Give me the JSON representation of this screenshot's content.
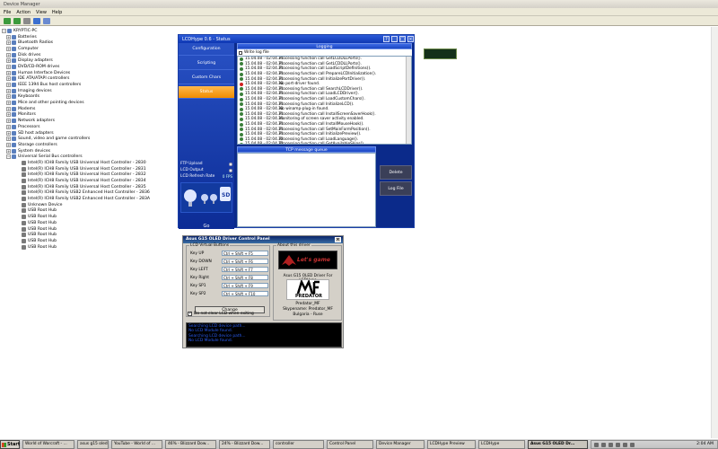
{
  "device_manager": {
    "title": "Device Manager",
    "menu": [
      "File",
      "Action",
      "View",
      "Help"
    ],
    "root": "KRYPTIC-PC",
    "tree": [
      {
        "label": "Batteries",
        "expanded": false
      },
      {
        "label": "Bluetooth Radios",
        "expanded": false
      },
      {
        "label": "Computer",
        "expanded": false
      },
      {
        "label": "Disk drives",
        "expanded": false
      },
      {
        "label": "Display adapters",
        "expanded": false
      },
      {
        "label": "DVD/CD-ROM drives",
        "expanded": false
      },
      {
        "label": "Human Interface Devices",
        "expanded": false
      },
      {
        "label": "IDE ATA/ATAPI controllers",
        "expanded": false
      },
      {
        "label": "IEEE 1394 Bus host controllers",
        "expanded": false
      },
      {
        "label": "Imaging devices",
        "expanded": false
      },
      {
        "label": "Keyboards",
        "expanded": false
      },
      {
        "label": "Mice and other pointing devices",
        "expanded": false
      },
      {
        "label": "Modems",
        "expanded": false
      },
      {
        "label": "Monitors",
        "expanded": false
      },
      {
        "label": "Network adapters",
        "expanded": false
      },
      {
        "label": "Processors",
        "expanded": false
      },
      {
        "label": "SD host adapters",
        "expanded": false
      },
      {
        "label": "Sound, video and game controllers",
        "expanded": false
      },
      {
        "label": "Storage controllers",
        "expanded": false
      },
      {
        "label": "System devices",
        "expanded": false
      },
      {
        "label": "Universal Serial Bus controllers",
        "expanded": true
      }
    ],
    "usb_children": [
      "Intel(R) ICH8 Family USB Universal Host Controller - 2830",
      "Intel(R) ICH8 Family USB Universal Host Controller - 2831",
      "Intel(R) ICH8 Family USB Universal Host Controller - 2832",
      "Intel(R) ICH8 Family USB Universal Host Controller - 2834",
      "Intel(R) ICH8 Family USB Universal Host Controller - 2835",
      "Intel(R) ICH8 Family USB2 Enhanced Host Controller - 2836",
      "Intel(R) ICH8 Family USB2 Enhanced Host Controller - 283A",
      "Unknown Device",
      "USB Root Hub",
      "USB Root Hub",
      "USB Root Hub",
      "USB Root Hub",
      "USB Root Hub",
      "USB Root Hub",
      "USB Root Hub"
    ]
  },
  "lcdhype": {
    "title": "LCDHype 0.6 - Status",
    "nav": [
      "Configuration",
      "Scripting",
      "Custom Chars",
      "Status"
    ],
    "active_nav": "Status",
    "options": [
      {
        "label": "FTP Upload",
        "value": ""
      },
      {
        "label": "LCD Output",
        "value": ""
      },
      {
        "label": "LCD Refresh Rate",
        "value": "0 FPS"
      }
    ],
    "go_label": "Go",
    "logging_header": "Logging",
    "write_log_label": "Write log file",
    "log_entries": [
      {
        "time": "15.04.08 - 02:04.31",
        "msg": "Processing function call GetLCDDLLPorts().",
        "error": false
      },
      {
        "time": "15.04.08 - 02:04.31",
        "msg": "Processing function call GetLCDDLLPorts().",
        "error": false
      },
      {
        "time": "15.04.08 - 02:04.31",
        "msg": "Processing function call LoadScriptDefinitions().",
        "error": false
      },
      {
        "time": "15.04.08 - 02:04.31",
        "msg": "Processing function call PrepareLCDInitialization().",
        "error": false
      },
      {
        "time": "15.04.08 - 02:04.31",
        "msg": "Processing function call InitializePortDriver().",
        "error": false
      },
      {
        "time": "15.04.08 - 02:04.31",
        "msg": "No port-driver found.",
        "error": true
      },
      {
        "time": "15.04.08 - 02:04.31",
        "msg": "Processing function call SearchLCDDriver().",
        "error": false
      },
      {
        "time": "15.04.08 - 02:04.31",
        "msg": "Processing function call LoadLCDDriver().",
        "error": false
      },
      {
        "time": "15.04.08 - 02:04.31",
        "msg": "Processing function call LoadCustomChars().",
        "error": false
      },
      {
        "time": "15.04.08 - 02:04.31",
        "msg": "Processing function call InitializeLCD().",
        "error": false
      },
      {
        "time": "15.04.08 - 02:04.31",
        "msg": "No winamp-plug-in found.",
        "error": false
      },
      {
        "time": "15.04.08 - 02:04.31",
        "msg": "Processing function call InstallScreenSaverHook().",
        "error": false
      },
      {
        "time": "15.04.08 - 02:04.31",
        "msg": "Monitoring of screen saver activity enabled.",
        "error": false
      },
      {
        "time": "15.04.08 - 02:04.31",
        "msg": "Processing function call InstallMouseHook().",
        "error": false
      },
      {
        "time": "15.04.08 - 02:04.31",
        "msg": "Processing function call SetMainFormPosition().",
        "error": false
      },
      {
        "time": "15.04.08 - 02:04.31",
        "msg": "Processing function call InitializePreview().",
        "error": false
      },
      {
        "time": "15.04.08 - 02:04.32",
        "msg": "Processing function call LoadLanguage().",
        "error": false
      },
      {
        "time": "15.04.08 - 02:04.32",
        "msg": "Processing function call GetAvailableSkins().",
        "error": false
      }
    ],
    "tcp_header": "TCP message queue",
    "side_buttons": [
      "Delete",
      "Log File"
    ]
  },
  "asus_panel": {
    "title": "Asus G15 OLED Driver Control Panel",
    "virtual_buttons_legend": "LCD Virtual Buttons",
    "keys": [
      {
        "label": "Key UP",
        "value": "Ctrl + Shift + F5"
      },
      {
        "label": "Key DOWN",
        "value": "Ctrl + Shift + F6"
      },
      {
        "label": "Key LEFT",
        "value": "Ctrl + Shift + F7"
      },
      {
        "label": "Key Right",
        "value": "Ctrl + Shift + F8"
      },
      {
        "label": "Key SP1",
        "value": "Ctrl + Shift + F9"
      },
      {
        "label": "Key SP2",
        "value": "Ctrl + Shift + F10"
      }
    ],
    "change_label": "Change",
    "dont_clear_label": "Do not clear LCD when exiting",
    "about_legend": "About this driver",
    "banner_text": "Let's game",
    "about_desc": "Asus G15 OLED Driver For LCDHype",
    "predator_text": "PREDATOR",
    "about_lines": [
      "Predator_MF",
      "Skypename: Predator_MF",
      "Bulgaria - Ruse"
    ],
    "console_lines": [
      "Searching LCD device path...",
      "No LCD Module found.",
      "Searching LCD device path...",
      "No LCD Module found."
    ]
  },
  "taskbar": {
    "start_label": "Start",
    "tasks": [
      {
        "label": "World of Warcraft - ...",
        "active": false
      },
      {
        "label": "asus g15 oled displa...",
        "active": false
      },
      {
        "label": "YouTube - World of ...",
        "active": false
      },
      {
        "label": "46% - Blizzard Dow...",
        "active": false
      },
      {
        "label": "24% - Blizzard Dow...",
        "active": false
      },
      {
        "label": "controller",
        "active": false
      },
      {
        "label": "Control Panel",
        "active": false
      },
      {
        "label": "Device Manager",
        "active": false
      },
      {
        "label": "LCDHype Preview",
        "active": false
      },
      {
        "label": "LCDHype",
        "active": false
      },
      {
        "label": "Asus G15 OLED Dr...",
        "active": true
      }
    ],
    "clock": "2:04 AM"
  },
  "colors": {
    "lcd_blue": "#0b2a8a",
    "status_orange": "#f08c00",
    "console_blue": "#2a5cf0",
    "banner_red": "#c53030"
  }
}
